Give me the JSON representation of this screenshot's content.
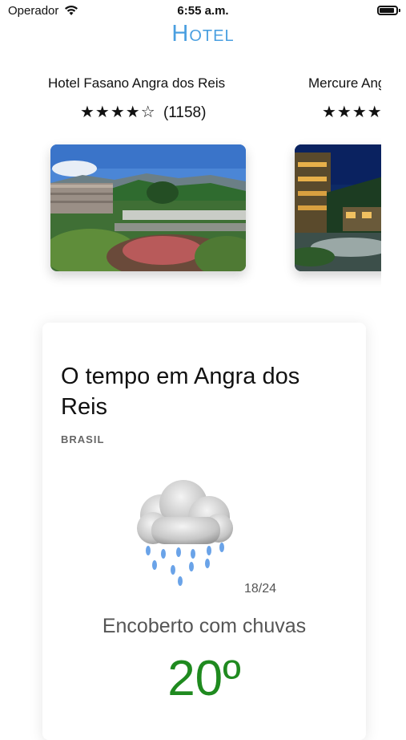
{
  "status_bar": {
    "carrier": "Operador",
    "time": "6:55 a.m."
  },
  "nav": {
    "title": "Hotel",
    "accent_color": "#4a9fe0"
  },
  "hotels": [
    {
      "name": "Hotel Fasano Angra dos Reis",
      "stars": "★★★★☆",
      "rating": 4.5,
      "reviews": "(1158)"
    },
    {
      "name": "Mercure Angra dos Reis",
      "stars": "★★★★★",
      "reviews": ""
    }
  ],
  "weather": {
    "title": "O tempo em Angra dos Reis",
    "country": "BRASIL",
    "icon": "rain-cloud-icon",
    "date": "18/24",
    "description": "Encoberto com chuvas",
    "temperature": "20º",
    "temperature_color": "#1f8a1f"
  }
}
